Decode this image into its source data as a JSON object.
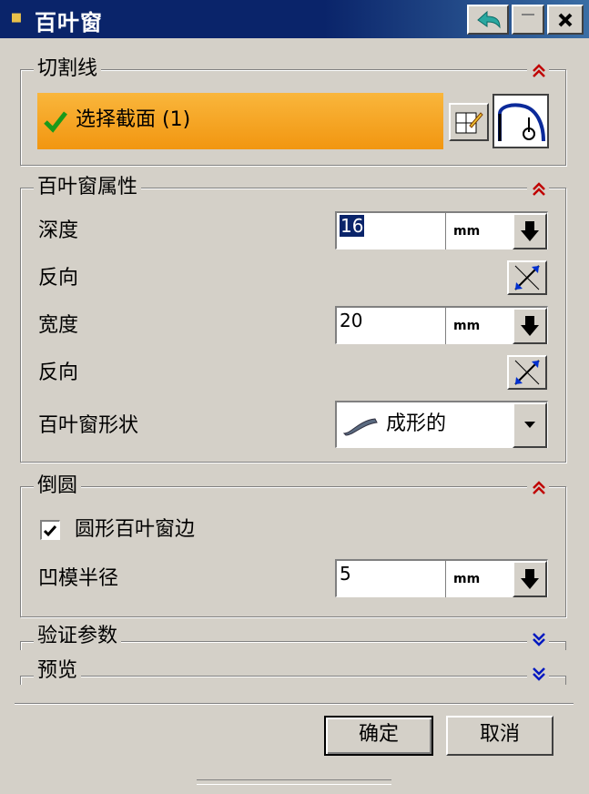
{
  "window": {
    "title": "百叶窗",
    "title_icon": "nx-app-icon"
  },
  "section_cut_line": {
    "title": "切割线",
    "select_label": "选择截面 (1)",
    "select_bg": "#f6a21e"
  },
  "section_props": {
    "title": "百叶窗属性",
    "depth_label": "深度",
    "depth_value": "16",
    "depth_unit": "mm",
    "reverse1_label": "反向",
    "width_label": "宽度",
    "width_value": "20",
    "width_unit": "mm",
    "reverse2_label": "反向",
    "shape_label": "百叶窗形状",
    "shape_value": "成形的"
  },
  "section_round": {
    "title": "倒圆",
    "round_edge_label": "圆形百叶窗边",
    "round_edge_checked": true,
    "die_radius_label": "凹模半径",
    "die_radius_value": "5",
    "die_radius_unit": "mm"
  },
  "section_verify": {
    "title": "验证参数"
  },
  "section_preview": {
    "title": "预览"
  },
  "buttons": {
    "ok": "确定",
    "cancel": "取消"
  },
  "colors": {
    "chevron_red": "#c00000",
    "chevron_blue": "#0018c0",
    "titlebar": "#0a246a"
  }
}
